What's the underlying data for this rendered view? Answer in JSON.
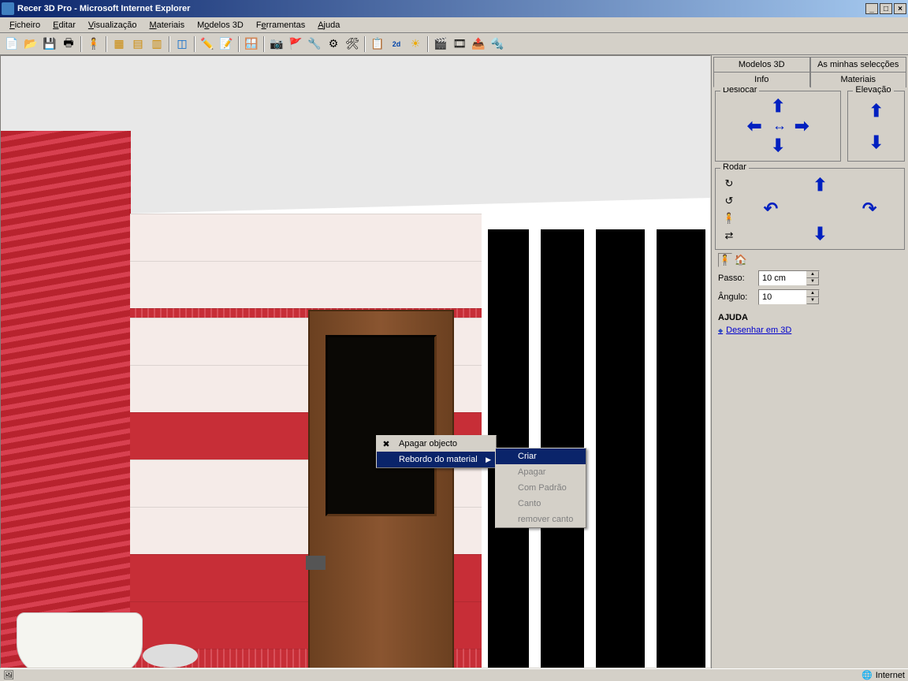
{
  "window": {
    "title": "Recer 3D Pro - Microsoft Internet Explorer"
  },
  "menubar": {
    "ficheiro": "Ficheiro",
    "editar": "Editar",
    "visualizacao": "Visualização",
    "materiais": "Materiais",
    "modelos3d": "Modelos 3D",
    "ferramentas": "Ferramentas",
    "ajuda": "Ajuda"
  },
  "tabs": {
    "modelos3d": "Modelos 3D",
    "selecoes": "As minhas selecções",
    "info": "Info",
    "materiais": "Materiais"
  },
  "groups": {
    "deslocar": "Deslocar",
    "elevacao": "Elevação",
    "rodar": "Rodar"
  },
  "controls": {
    "passo_label": "Passo:",
    "passo_value": "10 cm",
    "angulo_label": "Ângulo:",
    "angulo_value": "10"
  },
  "help": {
    "header": "AJUDA",
    "link1": "Desenhar em 3D"
  },
  "contextmenu": {
    "apagar_objecto": "Apagar objecto",
    "rebordo": "Rebordo do material",
    "sub": {
      "criar": "Criar",
      "apagar": "Apagar",
      "com_padrao": "Com Padrão",
      "canto": "Canto",
      "remover_canto": "remover canto"
    }
  },
  "statusbar": {
    "right": "Internet"
  }
}
